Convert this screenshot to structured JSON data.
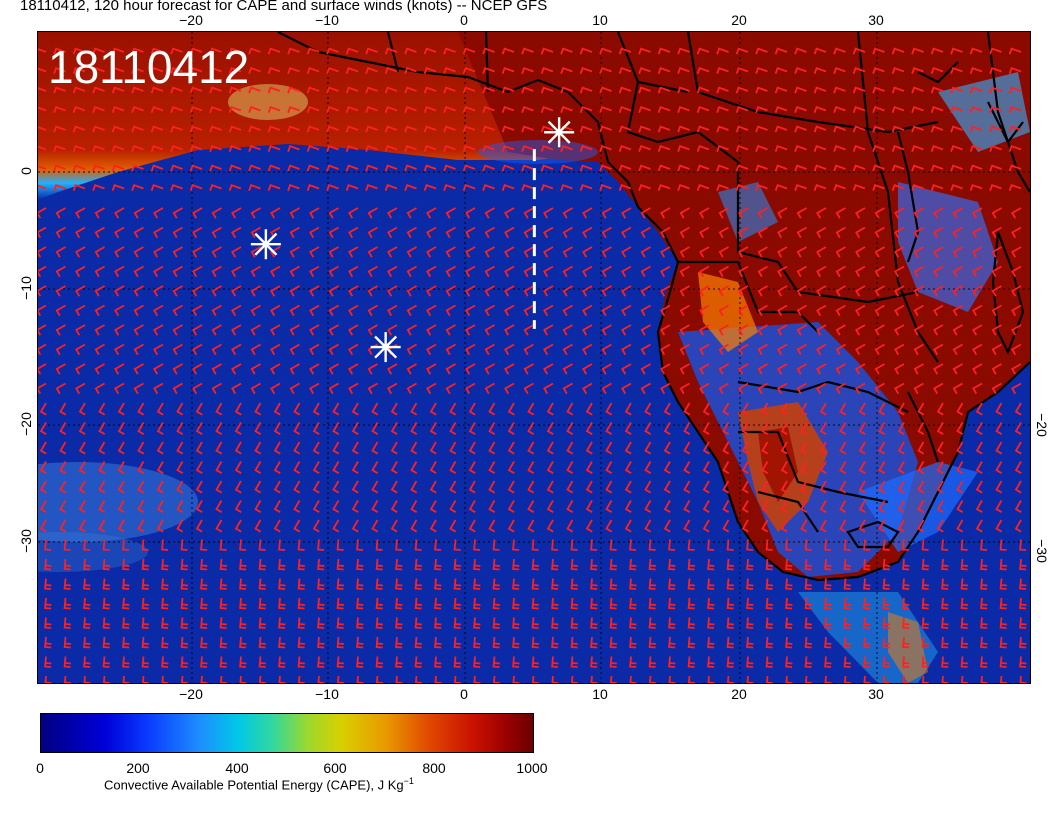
{
  "title": "18110412, 120 hour forecast for CAPE and surface winds (knots) -- NCEP GFS",
  "date_label": "18110412",
  "axes": {
    "x_ticks": [
      "−20",
      "−10",
      "0",
      "10",
      "20",
      "30"
    ],
    "y_ticks": [
      "0",
      "−10",
      "−20",
      "−30"
    ],
    "lon_range": [
      -31,
      41
    ],
    "lat_range": [
      -42,
      8
    ]
  },
  "colorbar": {
    "label_main": "Convective Available Potential Energy (CAPE), J Kg",
    "label_sup": "−1",
    "ticks": [
      "0",
      "200",
      "400",
      "600",
      "800",
      "1000"
    ],
    "range": [
      0,
      1000
    ]
  },
  "colors": {
    "ocean_low": "#00209a",
    "land_high": "#8a0a00",
    "barbs": "#ff2020",
    "borders": "#000000",
    "markers": "#ffffff"
  },
  "markers": [
    {
      "name": "asterisk-1",
      "lon": -14.5,
      "lat": -8.3
    },
    {
      "name": "asterisk-2",
      "lon": -5.8,
      "lat": -16.2
    },
    {
      "name": "asterisk-3",
      "lon": 6.8,
      "lat": 0.3
    }
  ],
  "track": {
    "lon": 5.0,
    "lat_from": -1.0,
    "lat_to": -14.8
  }
}
